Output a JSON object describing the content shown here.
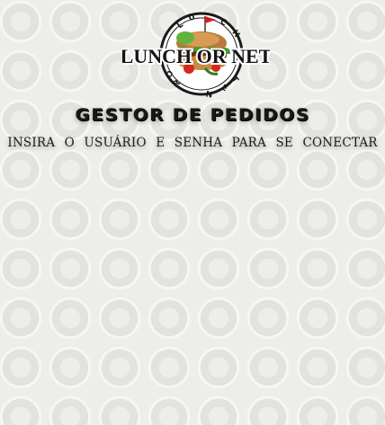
{
  "logo": {
    "wordmark": "LUNCH OR NET",
    "ring_top": "LUNCH",
    "ring_bottom": "OR NET"
  },
  "header": {
    "title": "GESTOR DE PEDIDOS",
    "subtitle": "INSIRA O USUÁRIO E SENHA PARA SE CONECTAR"
  }
}
